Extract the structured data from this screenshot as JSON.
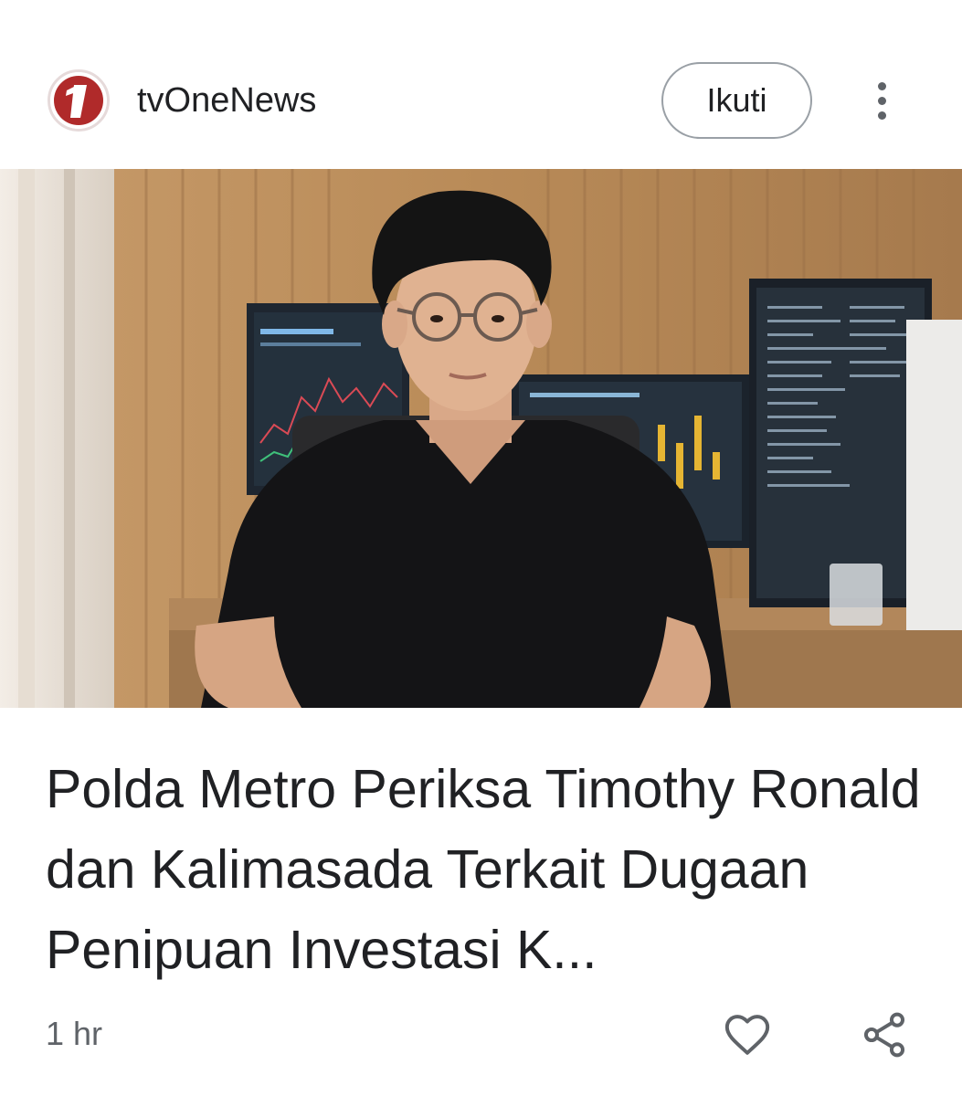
{
  "header": {
    "source_name": "tvOneNews",
    "logo_icon": "tvone-logo-icon",
    "follow_label": "Ikuti",
    "more_icon": "more-vert-icon"
  },
  "article": {
    "image_icon": "article-photo",
    "headline": "Polda Metro Periksa Timothy Ronald dan Kalimasada Terkait Dugaan Penipuan Investasi K...",
    "time": "1 hr",
    "like_icon": "heart-icon",
    "share_icon": "share-icon"
  },
  "colors": {
    "brand": "#b02a2a",
    "text": "#202124",
    "secondary": "#5f6368"
  }
}
